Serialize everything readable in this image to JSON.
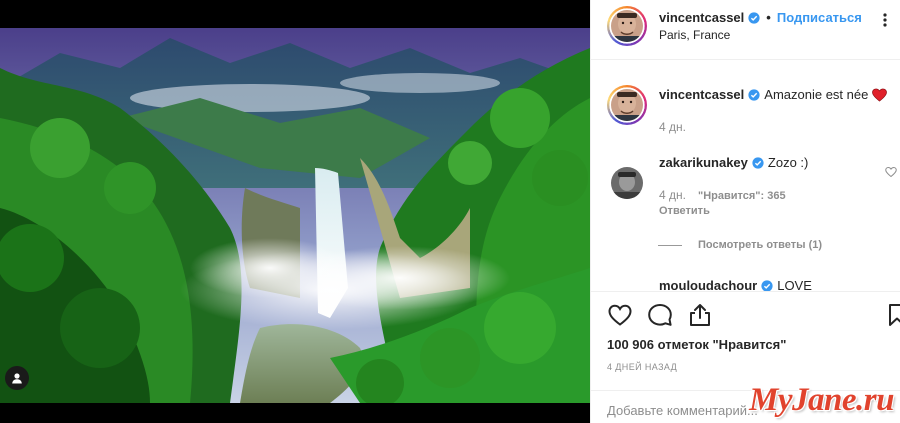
{
  "post": {
    "author": "vincentcassel",
    "follow_label": "Подписаться",
    "location": "Paris, France"
  },
  "comments": [
    {
      "user": "vincentcassel",
      "text": "Amazonie est née",
      "time": "4 дн."
    },
    {
      "user": "zakarikunakey",
      "text": "Zozo :)",
      "time": "4 дн.",
      "likes": "\"Нравится\": 365",
      "reply": "Ответить",
      "view_replies": "Посмотреть ответы (1)"
    },
    {
      "user": "mouloudachour",
      "text": "LOVE"
    }
  ],
  "likes_text": "100 906 отметок \"Нравится\"",
  "date_text": "4 ДНЕЙ НАЗАД",
  "add_comment_placeholder": "Добавьте комментарий...",
  "watermark": "MyJane.ru",
  "colors": {
    "accent": "#3897f0",
    "heart": "#ed4956",
    "watermark": "#e1432d"
  },
  "icons": [
    "verified-badge-icon",
    "more-options-icon",
    "heart-icon",
    "comment-icon",
    "share-icon",
    "bookmark-icon",
    "user-tag-icon"
  ]
}
